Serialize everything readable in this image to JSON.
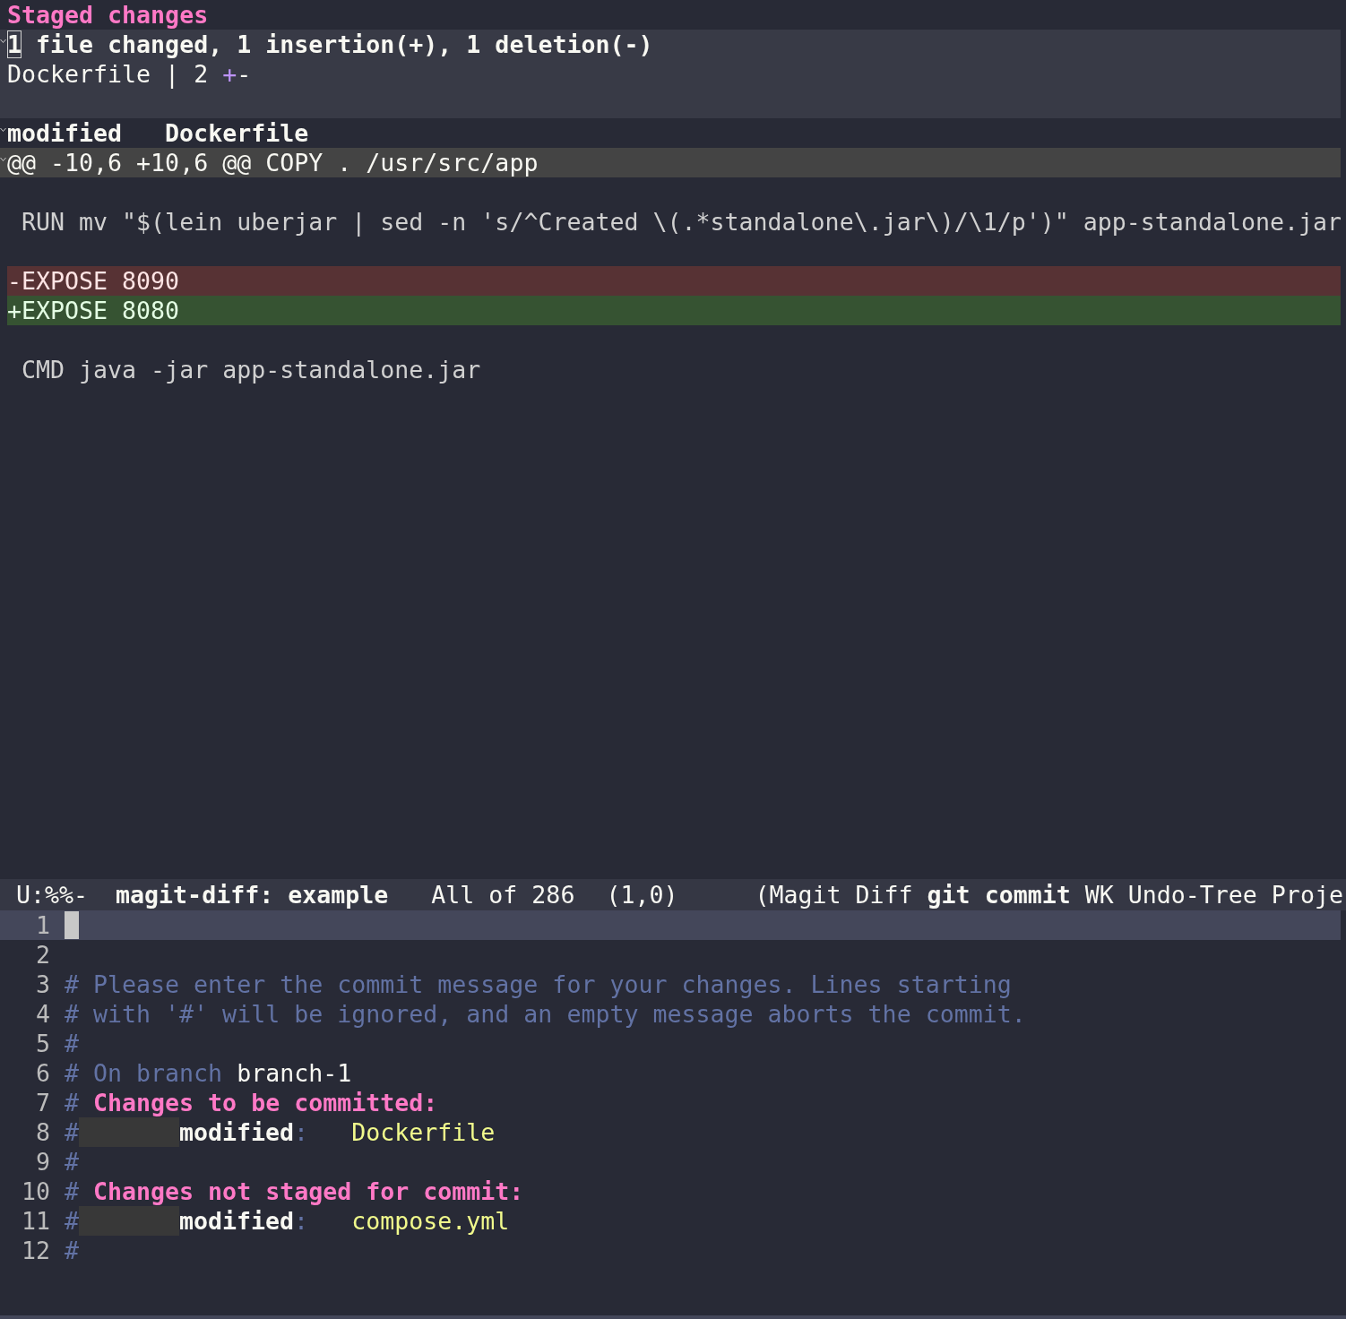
{
  "diff": {
    "section_title": "Staged changes",
    "stats": {
      "expanded": true,
      "summary": "1 file changed, 1 insertion(+), 1 deletion(-)",
      "files": [
        {
          "file": "Dockerfile | 2 ",
          "insertions": "+",
          "deletions": "-"
        }
      ]
    },
    "file": {
      "expanded": true,
      "status": "modified",
      "name": "Dockerfile"
    },
    "hunk": {
      "expanded": true,
      "header": "@@ -10,6 +10,6 @@ COPY . /usr/src/app"
    },
    "lines": [
      {
        "kind": "blank"
      },
      {
        "kind": "context",
        "text": " RUN mv \"$(lein uberjar | sed -n 's/^Created \\(.*standalone\\.jar\\)/\\1/p')\" app-standalone.jar"
      },
      {
        "kind": "blank"
      },
      {
        "kind": "removed",
        "text": "-EXPOSE 8090"
      },
      {
        "kind": "added",
        "text": "+EXPOSE 8080"
      },
      {
        "kind": "blank"
      },
      {
        "kind": "context",
        "text": " CMD java -jar app-standalone.jar"
      }
    ]
  },
  "mode_line": {
    "state": "U:%%-",
    "buffer": "magit-diff: example",
    "position": "All of 286",
    "cursor": "(1,0)",
    "modes": "(Magit Diff **git commit** WK Undo-Tree Proje"
  },
  "editor": {
    "lines": [
      {
        "number": "1",
        "current": true
      },
      {
        "number": "2",
        "current": false
      },
      {
        "number": "3",
        "current": false,
        "segments": [
          {
            "kind": "comment",
            "text": "# Please enter the commit message for your changes. Lines starting"
          }
        ]
      },
      {
        "number": "4",
        "current": false,
        "segments": [
          {
            "kind": "comment",
            "text": "# with '#' will be ignored, and an empty message aborts the commit."
          }
        ]
      },
      {
        "number": "5",
        "current": false,
        "segments": [
          {
            "kind": "comment",
            "text": "#"
          }
        ]
      },
      {
        "number": "6",
        "current": false,
        "segments": [
          {
            "kind": "comment",
            "text": "# On branch"
          },
          {
            "kind": "plain",
            "text": " branch-1"
          }
        ]
      },
      {
        "number": "7",
        "current": false,
        "segments": [
          {
            "kind": "comment",
            "text": "#"
          },
          {
            "kind": "heading",
            "text": " Changes to be committed:"
          }
        ]
      },
      {
        "number": "8",
        "current": false,
        "segments": [
          {
            "kind": "comment",
            "text": "#"
          },
          {
            "kind": "tab"
          },
          {
            "kind": "label",
            "text": "modified"
          },
          {
            "kind": "comment",
            "text": ":"
          },
          {
            "kind": "file",
            "text": "   Dockerfile"
          }
        ]
      },
      {
        "number": "9",
        "current": false,
        "segments": [
          {
            "kind": "comment",
            "text": "#"
          }
        ]
      },
      {
        "number": "10",
        "current": false,
        "segments": [
          {
            "kind": "comment",
            "text": "#"
          },
          {
            "kind": "heading",
            "text": " Changes not staged for commit:"
          }
        ]
      },
      {
        "number": "11",
        "current": false,
        "segments": [
          {
            "kind": "comment",
            "text": "#"
          },
          {
            "kind": "tab"
          },
          {
            "kind": "label",
            "text": "modified"
          },
          {
            "kind": "comment",
            "text": ":"
          },
          {
            "kind": "file",
            "text": "   compose.yml"
          }
        ]
      },
      {
        "number": "12",
        "current": false,
        "segments": [
          {
            "kind": "comment",
            "text": "#"
          }
        ]
      }
    ]
  }
}
